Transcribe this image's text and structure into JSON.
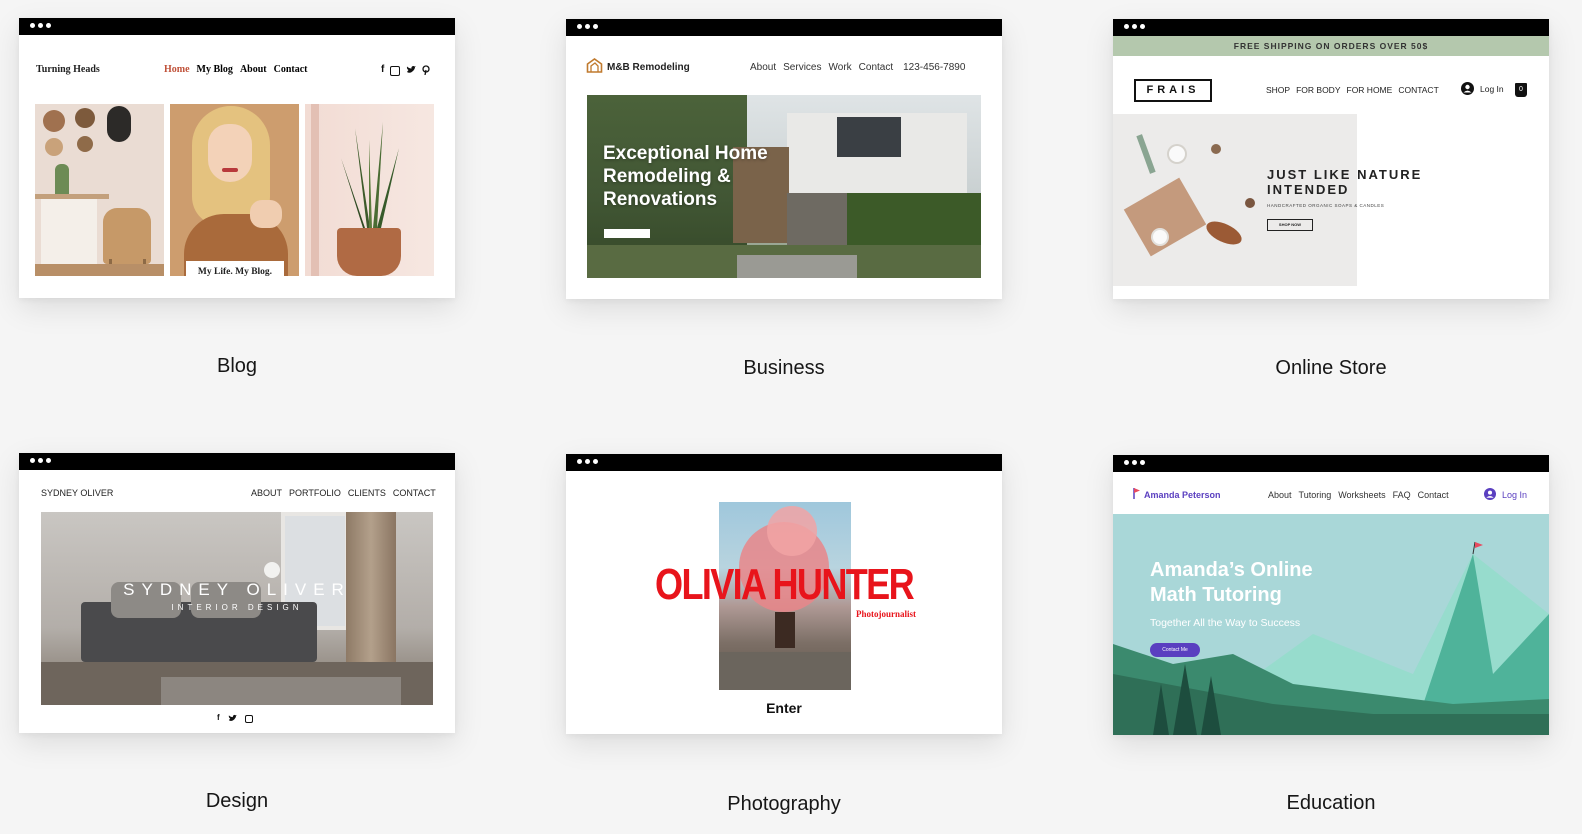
{
  "templates": [
    {
      "caption": "Blog",
      "site_title": "Turning Heads",
      "nav": [
        "Home",
        "My Blog",
        "About",
        "Contact"
      ],
      "social_icons": [
        "facebook-icon",
        "instagram-icon",
        "twitter-icon",
        "pinterest-icon"
      ],
      "photo_caption": "My Life. My Blog.",
      "colors": {
        "active_nav": "#c0523a"
      }
    },
    {
      "caption": "Business",
      "logo_text": "M&B Remodeling",
      "nav": [
        "About",
        "Services",
        "Work",
        "Contact"
      ],
      "phone": "123-456-7890",
      "hero_text": "Exceptional Home Remodeling & Renovations",
      "colors": {
        "logo_icon": "#c07a2e"
      }
    },
    {
      "caption": "Online Store",
      "banner": "FREE SHIPPING ON ORDERS OVER 50$",
      "logo": "FRAIS",
      "nav": [
        "SHOP",
        "FOR BODY",
        "FOR HOME",
        "CONTACT"
      ],
      "login": "Log In",
      "cart_count": "0",
      "headline": "JUST LIKE NATURE INTENDED",
      "subhead": "HANDCRAFTED ORGANIC SOAPS & CANDLES",
      "button": "SHOP NOW",
      "colors": {
        "banner_bg": "#b4c8ad"
      }
    },
    {
      "caption": "Design",
      "site_name": "SYDNEY OLIVER",
      "nav": [
        "ABOUT",
        "PORTFOLIO",
        "CLIENTS",
        "CONTACT"
      ],
      "hero_title": "SYDNEY OLIVER",
      "hero_subtitle": "INTERIOR DESIGN",
      "social_icons": [
        "facebook-icon",
        "twitter-icon",
        "instagram-icon"
      ]
    },
    {
      "caption": "Photography",
      "name": "OLIVIA HUNTER",
      "role": "Photojournalist",
      "enter": "Enter",
      "colors": {
        "name": "#e8141b"
      }
    },
    {
      "caption": "Education",
      "logo_text": "Amanda Peterson",
      "nav": [
        "About",
        "Tutoring",
        "Worksheets",
        "FAQ",
        "Contact"
      ],
      "login": "Log In",
      "headline_line1": "Amanda’s Online",
      "headline_line2": "Math Tutoring",
      "tagline": "Together All the Way to Success",
      "button": "Contact Me",
      "colors": {
        "accent": "#5a3fc0",
        "hero_bg": "#a9d7d8"
      }
    }
  ]
}
